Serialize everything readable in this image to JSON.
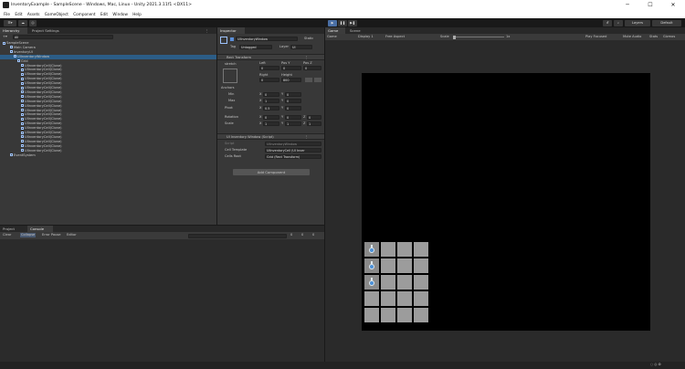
{
  "window": {
    "title": "InventoryExample - SampleScene - Windows, Mac, Linux - Unity 2021.3.11f1 <DX11>",
    "min": "─",
    "max": "☐",
    "close": "✕"
  },
  "menu": [
    "File",
    "Edit",
    "Assets",
    "GameObject",
    "Component",
    "Edit",
    "Window",
    "Help"
  ],
  "toolbar": {
    "account": "Layers",
    "layout": "Default"
  },
  "hierarchy": {
    "tabs": [
      "Hierarchy",
      "Project Settings"
    ],
    "search_placeholder": "All",
    "rows": [
      {
        "text": "SampleScene",
        "indent": 0
      },
      {
        "text": "Main Camera",
        "indent": 2
      },
      {
        "text": "InventoryUI",
        "indent": 2
      },
      {
        "text": "UIInventoryWindow",
        "indent": 3,
        "selected": true
      },
      {
        "text": "Grid",
        "indent": 4
      },
      {
        "text": "UIInventoryCell(Clone)",
        "indent": 5
      },
      {
        "text": "UIInventoryCell(Clone)",
        "indent": 5
      },
      {
        "text": "UIInventoryCell(Clone)",
        "indent": 5
      },
      {
        "text": "UIInventoryCell(Clone)",
        "indent": 5
      },
      {
        "text": "UIInventoryCell(Clone)",
        "indent": 5
      },
      {
        "text": "UIInventoryCell(Clone)",
        "indent": 5
      },
      {
        "text": "UIInventoryCell(Clone)",
        "indent": 5
      },
      {
        "text": "UIInventoryCell(Clone)",
        "indent": 5
      },
      {
        "text": "UIInventoryCell(Clone)",
        "indent": 5
      },
      {
        "text": "UIInventoryCell(Clone)",
        "indent": 5
      },
      {
        "text": "UIInventoryCell(Clone)",
        "indent": 5
      },
      {
        "text": "UIInventoryCell(Clone)",
        "indent": 5
      },
      {
        "text": "UIInventoryCell(Clone)",
        "indent": 5
      },
      {
        "text": "UIInventoryCell(Clone)",
        "indent": 5
      },
      {
        "text": "UIInventoryCell(Clone)",
        "indent": 5
      },
      {
        "text": "UIInventoryCell(Clone)",
        "indent": 5
      },
      {
        "text": "UIInventoryCell(Clone)",
        "indent": 5
      },
      {
        "text": "UIInventoryCell(Clone)",
        "indent": 5
      },
      {
        "text": "UIInventoryCell(Clone)",
        "indent": 5
      },
      {
        "text": "UIInventoryCell(Clone)",
        "indent": 5
      },
      {
        "text": "EventSystem",
        "indent": 2
      }
    ]
  },
  "inspector": {
    "tab": "Inspector",
    "object_name": "UIInventoryWindow",
    "static": "Static",
    "tag_label": "Tag",
    "tag_value": "Untagged",
    "layer_label": "Layer",
    "layer_value": "UI",
    "rect": {
      "header": "Rect Transform",
      "stretch": "stretch",
      "col1": "Left",
      "col2": "Pos Y",
      "col3": "Pos Z",
      "v1": "0",
      "v2": "0",
      "v3": "0",
      "col4": "Right",
      "col5": "Height",
      "v4": "0",
      "v5": "800",
      "anchors": "Anchors",
      "min": "Min",
      "min_x": "0",
      "min_y": "0",
      "max": "Max",
      "max_x": "1",
      "max_y": "0",
      "pivot": "Pivot",
      "pivot_x": "0.5",
      "pivot_y": "0",
      "rotation": "Rotation",
      "rot_x": "0",
      "rot_y": "0",
      "rot_z": "0",
      "scale": "Scale",
      "sc_x": "1",
      "sc_y": "1",
      "sc_z": "1",
      "x": "X",
      "y": "Y",
      "z": "Z"
    },
    "script": {
      "header": "UI Inventory Window (Script)",
      "script_label": "Script",
      "script_value": "UIInventoryWindow",
      "cell_label": "Cell Template",
      "cell_value": "UIInventoryCell (UI Inver",
      "root_label": "Cells Root",
      "root_value": "Grid (Rect Transform)"
    },
    "add_component": "Add Component"
  },
  "game": {
    "tabs": [
      "Game",
      "Scene"
    ],
    "view": "Game",
    "display": "Display 1",
    "aspect": "Free Aspect",
    "scale_label": "Scale",
    "scale_value": "1x",
    "play_mode": "Play Focused",
    "mute": "Mute Audio",
    "stats": "Stats",
    "gizmos": "Gizmos",
    "grid": {
      "rows": 5,
      "cols": 4,
      "filled": [
        0,
        4,
        8
      ]
    }
  },
  "bottom": {
    "tabs": [
      "Project",
      "Console"
    ],
    "clear": "Clear",
    "collapse": "Collapse",
    "error_pause": "Error Pause",
    "editor": "Editor",
    "counts": [
      "0",
      "0",
      "0"
    ]
  }
}
